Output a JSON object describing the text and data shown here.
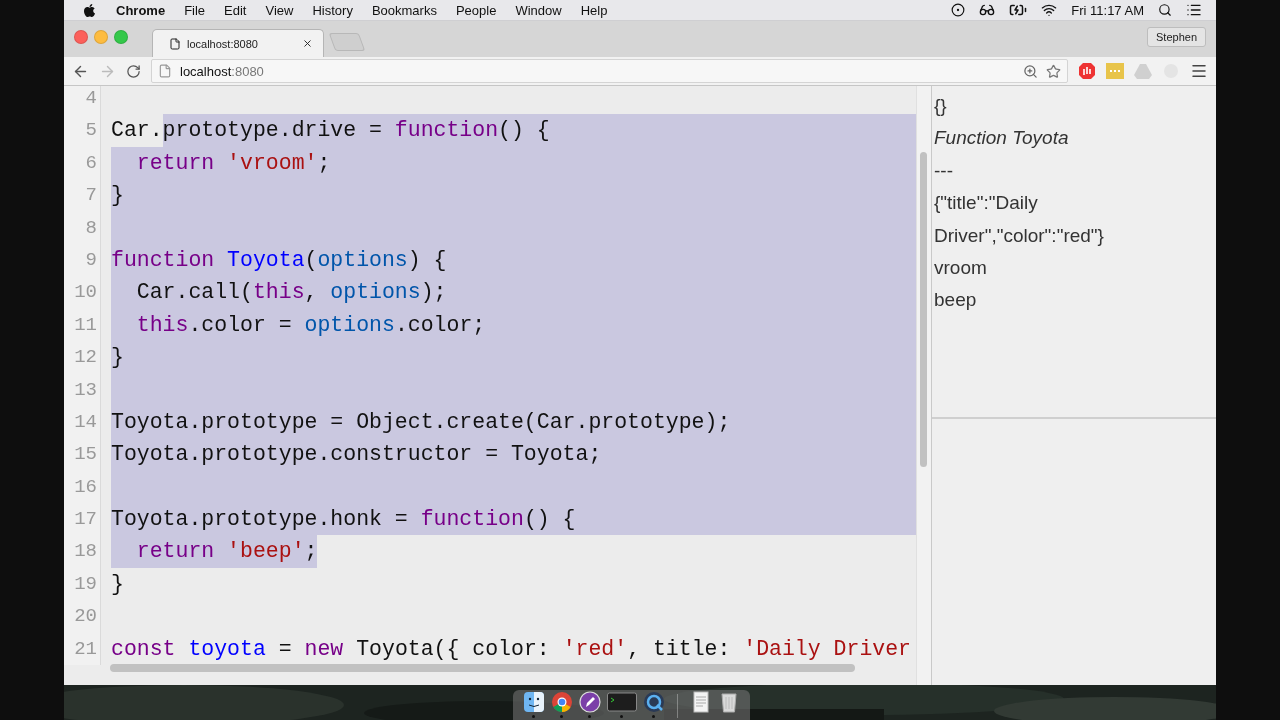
{
  "menu_bar": {
    "app": "Chrome",
    "menus": [
      "File",
      "Edit",
      "View",
      "History",
      "Bookmarks",
      "People",
      "Window",
      "Help"
    ],
    "clock": "Fri 11:17 AM"
  },
  "browser": {
    "tabs": [
      {
        "title": "localhost:8080",
        "selected": true
      }
    ],
    "profile": "Stephen",
    "back": {
      "disabled": false
    },
    "forward": {
      "disabled": true
    },
    "address": {
      "host": "localhost",
      "port": ":8080"
    }
  },
  "editor": {
    "lines": [
      {
        "number": "4",
        "selected": false
      },
      {
        "number": "5",
        "selected": true,
        "tokens": [
          {
            "text": "Car.",
            "kind": "plain",
            "selected": false
          },
          {
            "text": "prototype.drive = ",
            "kind": "plain",
            "selected": true
          },
          {
            "text": "function",
            "kind": "keyword",
            "selected": true
          },
          {
            "text": "() {",
            "kind": "plain",
            "selected": true
          }
        ]
      },
      {
        "number": "6",
        "selected": true,
        "tokens": [
          {
            "text": "  return",
            "kind": "keyword"
          },
          {
            "text": " 'vroom'",
            "kind": "string"
          },
          {
            "text": ";",
            "kind": "plain"
          }
        ]
      },
      {
        "number": "7",
        "selected": true,
        "tokens": [
          {
            "text": "}",
            "kind": "plain"
          }
        ]
      },
      {
        "number": "8",
        "selected": true
      },
      {
        "number": "9",
        "selected": true,
        "tokens": [
          {
            "text": "function",
            "kind": "keyword"
          },
          {
            "text": " Toyota",
            "kind": "def"
          },
          {
            "text": "(",
            "kind": "plain"
          },
          {
            "text": "options",
            "kind": "variable"
          },
          {
            "text": ") {",
            "kind": "plain"
          }
        ]
      },
      {
        "number": "10",
        "selected": true,
        "tokens": [
          {
            "text": "  Car.call(",
            "kind": "plain"
          },
          {
            "text": "this",
            "kind": "keyword"
          },
          {
            "text": ", ",
            "kind": "plain"
          },
          {
            "text": "options",
            "kind": "variable"
          },
          {
            "text": ");",
            "kind": "plain"
          }
        ]
      },
      {
        "number": "11",
        "selected": true,
        "tokens": [
          {
            "text": "  this",
            "kind": "keyword"
          },
          {
            "text": ".color = ",
            "kind": "plain"
          },
          {
            "text": "options",
            "kind": "variable"
          },
          {
            "text": ".color;",
            "kind": "plain"
          }
        ]
      },
      {
        "number": "12",
        "selected": true,
        "tokens": [
          {
            "text": "}",
            "kind": "plain"
          }
        ]
      },
      {
        "number": "13",
        "selected": true
      },
      {
        "number": "14",
        "selected": true,
        "tokens": [
          {
            "text": "Toyota.prototype = Object.create(Car.prototype);",
            "kind": "plain"
          }
        ]
      },
      {
        "number": "15",
        "selected": true,
        "tokens": [
          {
            "text": "Toyota.prototype.constructor = Toyota;",
            "kind": "plain"
          }
        ]
      },
      {
        "number": "16",
        "selected": true
      },
      {
        "number": "17",
        "selected": true,
        "tokens": [
          {
            "text": "Toyota.prototype.honk = ",
            "kind": "plain"
          },
          {
            "text": "function",
            "kind": "keyword"
          },
          {
            "text": "() {",
            "kind": "plain"
          }
        ]
      },
      {
        "number": "18",
        "selected": false,
        "tokens": [
          {
            "text": "  return",
            "kind": "keyword",
            "selected": true
          },
          {
            "text": " 'beep'",
            "kind": "string",
            "selected": true
          },
          {
            "text": ";",
            "kind": "plain",
            "selected": true
          }
        ]
      },
      {
        "number": "19",
        "selected": false,
        "tokens": [
          {
            "text": "}",
            "kind": "plain"
          }
        ]
      },
      {
        "number": "20",
        "selected": false
      },
      {
        "number": "21",
        "selected": false,
        "tokens": [
          {
            "text": "const",
            "kind": "keyword"
          },
          {
            "text": " toyota",
            "kind": "def"
          },
          {
            "text": " = ",
            "kind": "plain"
          },
          {
            "text": "new",
            "kind": "keyword"
          },
          {
            "text": " Toyota({ color: ",
            "kind": "plain"
          },
          {
            "text": "'red'",
            "kind": "string"
          },
          {
            "text": ", title: ",
            "kind": "plain"
          },
          {
            "text": "'Daily Driver",
            "kind": "string"
          }
        ]
      }
    ]
  },
  "output": {
    "lines": [
      {
        "text": "{}",
        "kind": "plain"
      },
      {
        "text": "Function Toyota",
        "kind": "italic"
      },
      {
        "text": "---",
        "kind": "plain"
      },
      {
        "text": "{\"title\":\"Daily Driver\",\"color\":\"red\"}",
        "kind": "plain"
      },
      {
        "text": "vroom",
        "kind": "plain"
      },
      {
        "text": "beep",
        "kind": "plain"
      }
    ]
  },
  "dock": {
    "apps": [
      {
        "kind": "finder",
        "running": true
      },
      {
        "kind": "browser",
        "running": true
      },
      {
        "kind": "pen",
        "running": true
      },
      {
        "kind": "terminal",
        "running": true
      },
      {
        "kind": "player",
        "running": true
      },
      {
        "kind": "document",
        "running": false
      },
      {
        "kind": "trash",
        "running": false
      }
    ]
  }
}
